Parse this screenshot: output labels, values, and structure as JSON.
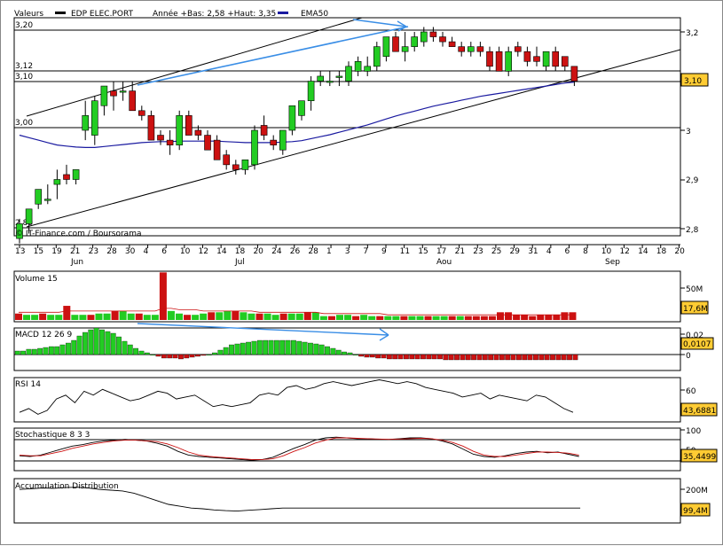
{
  "header": {
    "valeurs": "Valeurs",
    "ticker": "EDP ELEC.PORT",
    "annee": "Année +Bas: 2,58 +Haut: 3,35",
    "ema_legend": "EMA50"
  },
  "credit": "© IT-Finance.com / Boursorama",
  "colors": {
    "up": "#22cc22",
    "down": "#cc1111",
    "ema": "#1a1aa0",
    "arrow": "#3a8ee6",
    "value_box": "#ffcc33",
    "grid": "#000000"
  },
  "price_panel": {
    "left_levels": [
      "3,20",
      "3,12",
      "3,10",
      "3,00",
      "2,80"
    ],
    "right_ticks": [
      "3,2",
      "3",
      "2,9",
      "2,8"
    ],
    "current_value": "3,10"
  },
  "x_axis": {
    "day_labels": [
      "13",
      "15",
      "19",
      "21",
      "23",
      "28",
      "30",
      "4",
      "6",
      "10",
      "12",
      "14",
      "18",
      "20",
      "24",
      "26",
      "28",
      "1",
      "3",
      "7",
      "9",
      "11",
      "15",
      "17",
      "21",
      "23",
      "25",
      "29",
      "31",
      "4",
      "6",
      "8",
      "10",
      "12",
      "14",
      "18",
      "20"
    ],
    "month_labels": [
      "Jun",
      "Jul",
      "Aou",
      "Sep"
    ]
  },
  "panels": {
    "volume": {
      "title": "Volume 15",
      "ticks": [
        "50M"
      ],
      "value": "17,6M"
    },
    "macd": {
      "title": "MACD 12 26 9",
      "ticks": [
        "0,02",
        "0"
      ],
      "value": "0,0107"
    },
    "rsi": {
      "title": "RSI 14",
      "ticks": [
        "60"
      ],
      "value": "43,6881"
    },
    "stoch": {
      "title": "Stochastique 8 3 3",
      "ticks": [
        "100",
        "50"
      ],
      "value": "35,4499"
    },
    "accum": {
      "title": "Accumulation Distribution",
      "ticks": [
        "200M"
      ],
      "value": "99,4M"
    }
  },
  "chart_data": {
    "type": "candlestick",
    "candles": [
      {
        "o": 2.78,
        "h": 2.82,
        "l": 2.77,
        "c": 2.81
      },
      {
        "o": 2.81,
        "h": 2.84,
        "l": 2.79,
        "c": 2.84
      },
      {
        "o": 2.85,
        "h": 2.88,
        "l": 2.84,
        "c": 2.88
      },
      {
        "o": 2.86,
        "h": 2.89,
        "l": 2.85,
        "c": 2.86
      },
      {
        "o": 2.89,
        "h": 2.92,
        "l": 2.86,
        "c": 2.9
      },
      {
        "o": 2.91,
        "h": 2.93,
        "l": 2.89,
        "c": 2.9
      },
      {
        "o": 2.9,
        "h": 2.92,
        "l": 2.89,
        "c": 2.92
      },
      {
        "o": 3.0,
        "h": 3.06,
        "l": 2.98,
        "c": 3.03
      },
      {
        "o": 2.99,
        "h": 3.07,
        "l": 2.97,
        "c": 3.06
      },
      {
        "o": 3.05,
        "h": 3.09,
        "l": 3.03,
        "c": 3.09
      },
      {
        "o": 3.08,
        "h": 3.1,
        "l": 3.04,
        "c": 3.07
      },
      {
        "o": 3.08,
        "h": 3.1,
        "l": 3.06,
        "c": 3.08
      },
      {
        "o": 3.08,
        "h": 3.1,
        "l": 3.04,
        "c": 3.04
      },
      {
        "o": 3.04,
        "h": 3.05,
        "l": 3.02,
        "c": 3.03
      },
      {
        "o": 3.03,
        "h": 3.04,
        "l": 2.98,
        "c": 2.98
      },
      {
        "o": 2.99,
        "h": 3.0,
        "l": 2.97,
        "c": 2.98
      },
      {
        "o": 2.98,
        "h": 3.0,
        "l": 2.95,
        "c": 2.97
      },
      {
        "o": 2.97,
        "h": 3.04,
        "l": 2.96,
        "c": 3.03
      },
      {
        "o": 3.03,
        "h": 3.04,
        "l": 2.99,
        "c": 2.99
      },
      {
        "o": 3.0,
        "h": 3.01,
        "l": 2.98,
        "c": 2.99
      },
      {
        "o": 2.99,
        "h": 3.0,
        "l": 2.96,
        "c": 2.96
      },
      {
        "o": 2.98,
        "h": 2.99,
        "l": 2.94,
        "c": 2.94
      },
      {
        "o": 2.95,
        "h": 2.96,
        "l": 2.92,
        "c": 2.93
      },
      {
        "o": 2.93,
        "h": 2.94,
        "l": 2.91,
        "c": 2.92
      },
      {
        "o": 2.92,
        "h": 2.94,
        "l": 2.91,
        "c": 2.94
      },
      {
        "o": 2.93,
        "h": 3.01,
        "l": 2.92,
        "c": 3.0
      },
      {
        "o": 3.01,
        "h": 3.03,
        "l": 2.98,
        "c": 2.99
      },
      {
        "o": 2.98,
        "h": 2.99,
        "l": 2.96,
        "c": 2.97
      },
      {
        "o": 2.96,
        "h": 3.0,
        "l": 2.95,
        "c": 3.0
      },
      {
        "o": 3.0,
        "h": 3.05,
        "l": 2.99,
        "c": 3.05
      },
      {
        "o": 3.03,
        "h": 3.06,
        "l": 3.02,
        "c": 3.06
      },
      {
        "o": 3.06,
        "h": 3.11,
        "l": 3.04,
        "c": 3.1
      },
      {
        "o": 3.1,
        "h": 3.12,
        "l": 3.09,
        "c": 3.11
      },
      {
        "o": 3.1,
        "h": 3.12,
        "l": 3.09,
        "c": 3.1
      },
      {
        "o": 3.11,
        "h": 3.12,
        "l": 3.09,
        "c": 3.11
      },
      {
        "o": 3.1,
        "h": 3.14,
        "l": 3.09,
        "c": 3.13
      },
      {
        "o": 3.12,
        "h": 3.15,
        "l": 3.11,
        "c": 3.14
      },
      {
        "o": 3.12,
        "h": 3.15,
        "l": 3.11,
        "c": 3.13
      },
      {
        "o": 3.13,
        "h": 3.18,
        "l": 3.12,
        "c": 3.17
      },
      {
        "o": 3.15,
        "h": 3.19,
        "l": 3.14,
        "c": 3.19
      },
      {
        "o": 3.19,
        "h": 3.2,
        "l": 3.16,
        "c": 3.16
      },
      {
        "o": 3.16,
        "h": 3.2,
        "l": 3.14,
        "c": 3.17
      },
      {
        "o": 3.17,
        "h": 3.2,
        "l": 3.16,
        "c": 3.19
      },
      {
        "o": 3.18,
        "h": 3.21,
        "l": 3.17,
        "c": 3.2
      },
      {
        "o": 3.2,
        "h": 3.21,
        "l": 3.18,
        "c": 3.19
      },
      {
        "o": 3.19,
        "h": 3.2,
        "l": 3.17,
        "c": 3.18
      },
      {
        "o": 3.18,
        "h": 3.19,
        "l": 3.17,
        "c": 3.17
      },
      {
        "o": 3.17,
        "h": 3.18,
        "l": 3.15,
        "c": 3.16
      },
      {
        "o": 3.16,
        "h": 3.18,
        "l": 3.15,
        "c": 3.17
      },
      {
        "o": 3.17,
        "h": 3.18,
        "l": 3.15,
        "c": 3.16
      },
      {
        "o": 3.16,
        "h": 3.17,
        "l": 3.12,
        "c": 3.13
      },
      {
        "o": 3.16,
        "h": 3.17,
        "l": 3.12,
        "c": 3.12
      },
      {
        "o": 3.12,
        "h": 3.17,
        "l": 3.11,
        "c": 3.16
      },
      {
        "o": 3.17,
        "h": 3.18,
        "l": 3.15,
        "c": 3.16
      },
      {
        "o": 3.16,
        "h": 3.17,
        "l": 3.13,
        "c": 3.14
      },
      {
        "o": 3.15,
        "h": 3.17,
        "l": 3.13,
        "c": 3.14
      },
      {
        "o": 3.13,
        "h": 3.16,
        "l": 3.12,
        "c": 3.16
      },
      {
        "o": 3.16,
        "h": 3.17,
        "l": 3.12,
        "c": 3.13
      },
      {
        "o": 3.15,
        "h": 3.15,
        "l": 3.12,
        "c": 3.13
      },
      {
        "o": 3.13,
        "h": 3.13,
        "l": 3.09,
        "c": 3.1
      }
    ],
    "ema50": [
      2.99,
      2.985,
      2.98,
      2.975,
      2.97,
      2.968,
      2.966,
      2.965,
      2.965,
      2.967,
      2.969,
      2.971,
      2.973,
      2.975,
      2.976,
      2.977,
      2.977,
      2.978,
      2.978,
      2.978,
      2.978,
      2.978,
      2.977,
      2.976,
      2.975,
      2.975,
      2.975,
      2.975,
      2.976,
      2.977,
      2.979,
      2.983,
      2.987,
      2.991,
      2.996,
      3.001,
      3.006,
      3.011,
      3.017,
      3.023,
      3.029,
      3.034,
      3.039,
      3.044,
      3.049,
      3.053,
      3.057,
      3.061,
      3.065,
      3.069,
      3.072,
      3.075,
      3.078,
      3.081,
      3.084,
      3.087,
      3.09,
      3.093,
      3.096,
      3.098
    ],
    "volume": [
      5,
      4,
      4,
      5,
      4,
      4,
      11,
      4,
      4,
      4,
      5,
      5,
      7,
      7,
      5,
      5,
      4,
      4,
      37,
      7,
      5,
      4,
      4,
      5,
      6,
      6,
      7,
      7,
      6,
      5,
      5,
      5,
      4,
      5,
      5,
      5,
      6,
      6,
      3,
      3,
      4,
      4,
      3,
      4,
      3,
      3,
      3,
      3,
      3,
      3,
      3,
      3,
      3,
      3,
      3,
      3,
      3,
      3,
      3,
      3,
      6,
      6,
      4,
      4,
      3,
      4,
      4,
      4,
      6,
      6
    ],
    "volume_avg": [
      6,
      6,
      6,
      6,
      6,
      6,
      7,
      7,
      7,
      7,
      7,
      7,
      7,
      7,
      7,
      7,
      7,
      7,
      9,
      9,
      8,
      8,
      8,
      7,
      7,
      7,
      7,
      7,
      7,
      7,
      6,
      6,
      6,
      6,
      6,
      6,
      6,
      6,
      5,
      5,
      5,
      5,
      5,
      5,
      5,
      5,
      4,
      4,
      4,
      4,
      4,
      4,
      4,
      4,
      4,
      4,
      4,
      4,
      4,
      4,
      4,
      4,
      4,
      4,
      4,
      4,
      4,
      4,
      4,
      4
    ],
    "macd": [
      0.004,
      0.004,
      0.006,
      0.006,
      0.007,
      0.008,
      0.009,
      0.009,
      0.011,
      0.013,
      0.016,
      0.021,
      0.025,
      0.028,
      0.03,
      0.028,
      0.026,
      0.024,
      0.02,
      0.015,
      0.011,
      0.007,
      0.004,
      0.002,
      0.0,
      -0.002,
      -0.004,
      -0.004,
      -0.004,
      -0.005,
      -0.004,
      -0.003,
      -0.002,
      -0.001,
      0.0,
      0.002,
      0.005,
      0.008,
      0.011,
      0.012,
      0.013,
      0.014,
      0.015,
      0.016,
      0.016,
      0.016,
      0.016,
      0.016,
      0.016,
      0.016,
      0.015,
      0.014,
      0.013,
      0.012,
      0.011,
      0.009,
      0.007,
      0.005,
      0.003,
      0.002,
      0.0,
      -0.002,
      -0.003,
      -0.003,
      -0.004,
      -0.004,
      -0.005,
      -0.005,
      -0.005,
      -0.005,
      -0.005,
      -0.005,
      -0.005,
      -0.005,
      -0.005,
      -0.005,
      -0.006,
      -0.006,
      -0.006,
      -0.006,
      -0.006,
      -0.006,
      -0.006,
      -0.006,
      -0.006,
      -0.006,
      -0.006,
      -0.006,
      -0.006,
      -0.006,
      -0.006,
      -0.006,
      -0.006,
      -0.006,
      -0.006,
      -0.006,
      -0.006,
      -0.006,
      -0.006,
      -0.006
    ],
    "rsi": [
      40,
      44,
      38,
      42,
      54,
      58,
      50,
      62,
      58,
      64,
      60,
      56,
      52,
      54,
      58,
      62,
      60,
      54,
      56,
      58,
      52,
      46,
      48,
      46,
      48,
      50,
      58,
      60,
      58,
      66,
      68,
      64,
      66,
      70,
      72,
      70,
      68,
      70,
      72,
      74,
      72,
      70,
      72,
      70,
      66,
      64,
      62,
      60,
      56,
      58,
      60,
      54,
      58,
      56,
      54,
      52,
      58,
      56,
      50,
      44,
      40
    ],
    "stoch_k": [
      40,
      38,
      42,
      50,
      58,
      66,
      70,
      76,
      80,
      82,
      84,
      82,
      80,
      74,
      66,
      52,
      42,
      38,
      36,
      34,
      32,
      30,
      28,
      30,
      36,
      48,
      60,
      70,
      82,
      88,
      90,
      88,
      86,
      86,
      84,
      84,
      86,
      88,
      88,
      86,
      80,
      72,
      58,
      44,
      38,
      36,
      40,
      46,
      50,
      52,
      48,
      50,
      44,
      38
    ],
    "stoch_d": [
      42,
      40,
      40,
      46,
      52,
      60,
      66,
      72,
      76,
      80,
      82,
      82,
      80,
      78,
      72,
      62,
      50,
      42,
      38,
      36,
      34,
      32,
      30,
      30,
      32,
      40,
      52,
      62,
      74,
      82,
      88,
      88,
      87,
      86,
      85,
      84,
      85,
      86,
      87,
      86,
      82,
      76,
      66,
      52,
      42,
      38,
      38,
      42,
      46,
      50,
      50,
      49,
      47,
      42
    ],
    "accum": [
      190,
      192,
      194,
      193,
      195,
      196,
      194,
      190,
      188,
      186,
      180,
      170,
      160,
      150,
      145,
      140,
      138,
      135,
      133,
      132,
      134,
      136,
      138,
      140,
      140,
      140,
      140,
      140,
      140,
      140,
      140,
      140,
      140,
      140,
      140,
      140,
      140,
      140,
      140,
      140,
      140,
      140,
      140,
      140,
      140,
      140,
      140,
      140,
      140,
      140
    ]
  }
}
